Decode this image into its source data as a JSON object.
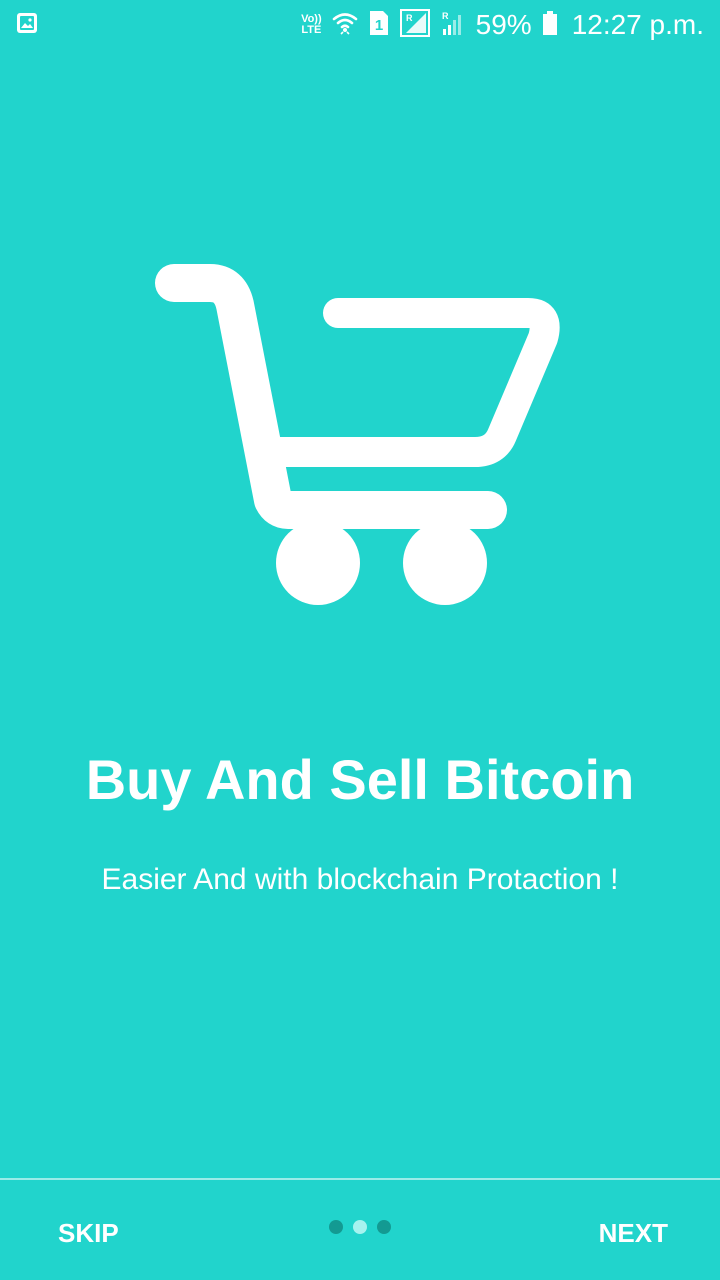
{
  "status_bar": {
    "volte_line1": "Vo))",
    "volte_line2": "LTE",
    "battery_percent": "59%",
    "time": "12:27 p.m.",
    "icons": [
      "gallery-icon",
      "volte-icon",
      "wifi-icon",
      "sim-1-icon",
      "signal-roaming-icon",
      "signal-icon",
      "battery-icon"
    ]
  },
  "onboarding": {
    "illustration": "shopping-cart-icon",
    "title": "Buy And Sell Bitcoin",
    "subtitle": "Easier And with blockchain Protaction !"
  },
  "navigation": {
    "skip_label": "SKIP",
    "next_label": "NEXT",
    "page_count": 3,
    "active_page": 2
  },
  "colors": {
    "background": "#21D4CC",
    "foreground": "#FFFFFF",
    "dot_inactive": "#139A92",
    "dot_active": "#A6F3EF"
  }
}
